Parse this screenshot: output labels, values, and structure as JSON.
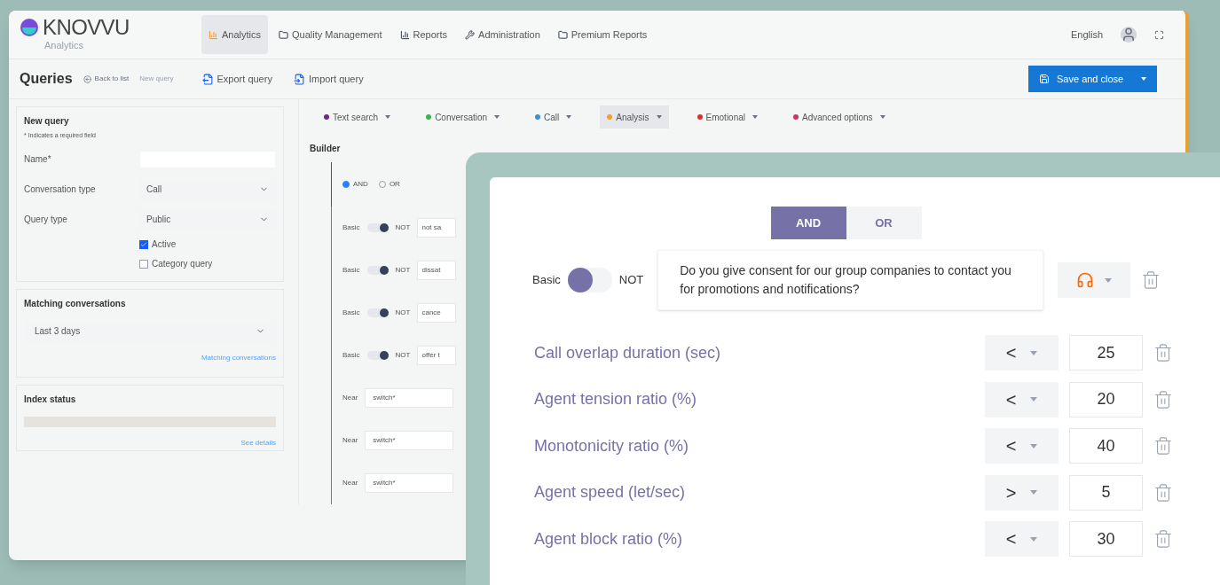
{
  "main_window": {
    "brand": {
      "name": "KNOVVU",
      "subtitle": "Analytics"
    },
    "nav": [
      {
        "label": "Analytics",
        "selected": true
      },
      {
        "label": "Quality Management",
        "selected": false
      },
      {
        "label": "Reports",
        "selected": false
      },
      {
        "label": "Administration",
        "selected": false
      },
      {
        "label": "Premium Reports",
        "selected": false
      }
    ],
    "language": "English",
    "toolbar": {
      "title": "Queries",
      "back": "Back to list",
      "crumb": "New query",
      "actions": [
        "Export query",
        "Import query"
      ],
      "save": "Save and close"
    },
    "new_query": {
      "title": "New query",
      "note": "* Indicates a required field",
      "fields": [
        {
          "label": "Name*",
          "kind": "text"
        },
        {
          "label": "Conversation type",
          "kind": "select",
          "value": "Call"
        },
        {
          "label": "Query type",
          "kind": "select",
          "value": "Public"
        }
      ],
      "checkboxes": [
        {
          "label": "Active",
          "checked": true
        },
        {
          "label": "Category query",
          "checked": false
        }
      ]
    },
    "matching": {
      "title": "Matching conversations",
      "period": "Last 3 days",
      "link": "Matching conversations"
    },
    "index_status": {
      "title": "Index status",
      "link": "See details",
      "level": 0
    },
    "filters": [
      {
        "label": "Text search",
        "color": "#6b2a8a",
        "selected": false
      },
      {
        "label": "Conversation",
        "color": "#3bb54a",
        "selected": false
      },
      {
        "label": "Call",
        "color": "#3a8fd8",
        "selected": false
      },
      {
        "label": "Analysis",
        "color": "#f0a030",
        "selected": true
      },
      {
        "label": "Emotional",
        "color": "#d93030",
        "selected": false
      },
      {
        "label": "Advanced options",
        "color": "#d0306a",
        "selected": false
      }
    ],
    "builder": {
      "title": "Builder",
      "logic": [
        {
          "label": "AND",
          "selected": true
        },
        {
          "label": "OR",
          "selected": false
        }
      ],
      "rows": [
        {
          "kind": "basic",
          "mode": "Basic",
          "not": "NOT",
          "negated": true,
          "value": "not sa"
        },
        {
          "kind": "basic",
          "mode": "Basic",
          "not": "NOT",
          "negated": true,
          "value": "dissat"
        },
        {
          "kind": "basic",
          "mode": "Basic",
          "not": "NOT",
          "negated": true,
          "value": "cance"
        },
        {
          "kind": "basic",
          "mode": "Basic",
          "not": "NOT",
          "negated": true,
          "value": "offer t"
        },
        {
          "kind": "near",
          "mode": "Near",
          "value": "switch*"
        },
        {
          "kind": "near",
          "mode": "Near",
          "value": "switch*"
        },
        {
          "kind": "near",
          "mode": "Near",
          "value": "switch*"
        }
      ]
    }
  },
  "detail_panel": {
    "logic": [
      {
        "label": "AND",
        "selected": true
      },
      {
        "label": "OR",
        "selected": false
      }
    ],
    "question": {
      "mode": "Basic",
      "not": "NOT",
      "negated": false,
      "text": "Do you give consent for our group companies to contact you for promotions and notifications?"
    },
    "metrics": [
      {
        "label": "Call overlap duration (sec)",
        "operator": "<",
        "value": "25"
      },
      {
        "label": "Agent tension ratio (%)",
        "operator": "<",
        "value": "20"
      },
      {
        "label": "Monotonicity ratio (%)",
        "operator": "<",
        "value": "40"
      },
      {
        "label": "Agent speed (let/sec)",
        "operator": ">",
        "value": "5"
      },
      {
        "label": "Agent block ratio (%)",
        "operator": "<",
        "value": "30"
      }
    ]
  }
}
